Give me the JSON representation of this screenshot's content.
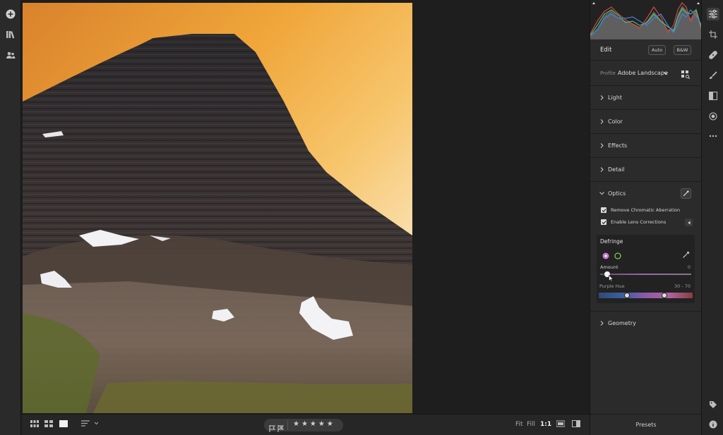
{
  "edit_panel": {
    "title": "Edit",
    "auto_label": "Auto",
    "bw_label": "B&W",
    "profile_label": "Profile",
    "profile_value": "Adobe Landscape"
  },
  "sections": {
    "light": "Light",
    "color": "Color",
    "effects": "Effects",
    "detail": "Detail",
    "optics": "Optics",
    "geometry": "Geometry"
  },
  "optics": {
    "remove_ca_label": "Remove Chromatic Aberration",
    "remove_ca_checked": true,
    "lens_corrections_label": "Enable Lens Corrections",
    "lens_corrections_checked": true
  },
  "defringe": {
    "title": "Defringe",
    "amount_label": "Amount",
    "amount_value": "0",
    "amount_fraction": 0.08,
    "purple_hue_label": "Purple Hue",
    "purple_hue_value": "30 - 70",
    "purple_hue_low_fraction": 0.3,
    "purple_hue_high_fraction": 0.7
  },
  "presets_label": "Presets",
  "bottom_bar": {
    "fit_label": "Fit",
    "fill_label": "Fill",
    "one_to_one_label": "1:1",
    "stars": [
      "★",
      "★",
      "★",
      "★",
      "★"
    ]
  },
  "colors": {
    "accent_purple": "#c37bd6",
    "accent_green": "#7fc35a",
    "sky_orange": "#f0a63a"
  }
}
